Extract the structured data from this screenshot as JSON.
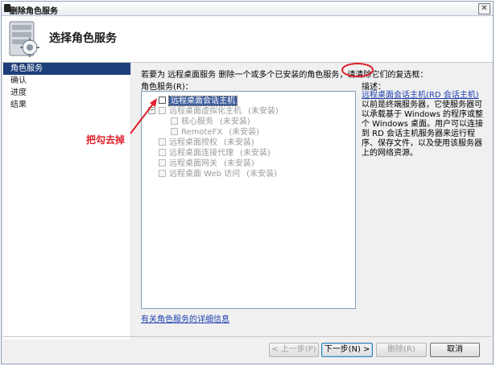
{
  "window": {
    "title": "删除角色服务",
    "close_label": "✕"
  },
  "header": {
    "title": "选择角色服务"
  },
  "nav": {
    "items": [
      "角色服务",
      "确认",
      "进度",
      "结果"
    ]
  },
  "instruction": "若要为 远程桌面服务 删除一个或多个已安装的角色服务，请清除它们的复选框：",
  "roles_label": "角色服务(R)：",
  "desc_label": "描述：",
  "roles": [
    {
      "label": "远程桌面会话主机",
      "status": ""
    },
    {
      "label": "远程桌面虚拟化主机",
      "status": "(未安装)"
    },
    {
      "label": "核心服务",
      "status": "(未安装)"
    },
    {
      "label": "RemoteFX",
      "status": "(未安装)"
    },
    {
      "label": "远程桌面授权",
      "status": "(未安装)"
    },
    {
      "label": "远程桌面连接代理",
      "status": "(未安装)"
    },
    {
      "label": "远程桌面网关",
      "status": "(未安装)"
    },
    {
      "label": "远程桌面 Web 访问",
      "status": "(未安装)"
    }
  ],
  "description": {
    "link": "远程桌面会话主机(RD 会话主机)",
    "text": "以前是终端服务器，它使服务器可以承载基于 Windows 的程序或整个 Windows 桌面。用户可以连接到 RD 会话主机服务器来运行程序、保存文件，以及使用该服务器上的网络资源。"
  },
  "more_link": "有关角色服务的详细信息",
  "buttons": {
    "prev": "< 上一步(P)",
    "next": "下一步(N) >",
    "remove": "删除(R)",
    "cancel": "取消"
  },
  "annotation": "把勾去掉",
  "colors": {
    "nav_active": "#1c3e79",
    "link": "#1f3fb0",
    "annotation": "#e0202b"
  }
}
